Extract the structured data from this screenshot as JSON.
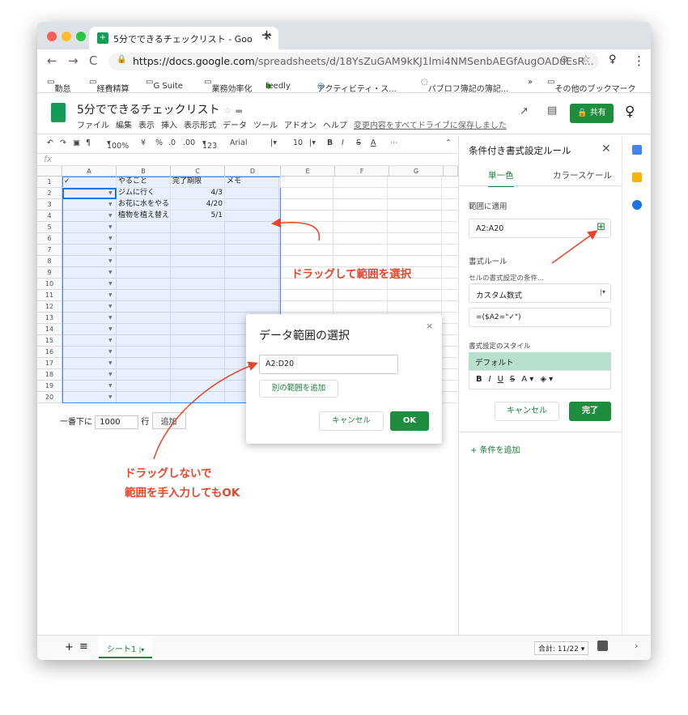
{
  "browser": {
    "tab_title": "5分でできるチェックリスト - Goo",
    "url_host": "https://docs.google.com",
    "url_path": "/spreadsheets/d/18YsZuGAM9kKJ1lmi4NMSenbAEGfAugOADuEsR...",
    "bookmarks": [
      "勤怠",
      "経費精算",
      "G Suite",
      "業務効率化",
      "feedly",
      "アクティビティ・ス...",
      "パブロフ簿記の簿記...",
      "»",
      "その他のブックマーク"
    ]
  },
  "doc": {
    "title": "5分でできるチェックリスト",
    "menus": [
      "ファイル",
      "編集",
      "表示",
      "挿入",
      "表示形式",
      "データ",
      "ツール",
      "アドオン",
      "ヘルプ"
    ],
    "saved_text": "変更内容をすべてドライブに保存しました",
    "share_label": "共有"
  },
  "toolbar": {
    "zoom": "100%",
    "currency": "¥",
    "percent": "%",
    "dec_less": ".0",
    "dec_more": ".00",
    "format": "123",
    "font": "Arial",
    "size": "10",
    "bold": "B",
    "italic": "I",
    "strike": "S",
    "color": "A",
    "more": "⋯"
  },
  "fx": "fx",
  "grid": {
    "columns": [
      "A",
      "B",
      "C",
      "D",
      "E",
      "F",
      "G"
    ],
    "rows": [
      "1",
      "2",
      "3",
      "4",
      "5",
      "6",
      "7",
      "8",
      "9",
      "10",
      "11",
      "12",
      "13",
      "14",
      "15",
      "16",
      "17",
      "18",
      "19",
      "20"
    ],
    "header": [
      "✓",
      "やること",
      "完了期限",
      "メモ"
    ],
    "data": [
      {
        "task": "ジムに行く",
        "due": "4/3"
      },
      {
        "task": "お花に水をやる",
        "due": "4/20"
      },
      {
        "task": "植物を植え替え",
        "due": "5/1"
      }
    ]
  },
  "below_grid": {
    "prefix": "一番下に",
    "count": "1000",
    "suffix": "行",
    "add": "追加"
  },
  "sheet_tab": "シート1",
  "sum_label": "合計: 11/22",
  "panel": {
    "title": "条件付き書式設定ルール",
    "tab_single": "単一色",
    "tab_scale": "カラースケール",
    "range_label": "範囲に適用",
    "range_value": "A2:A20",
    "rules_label": "書式ルール",
    "condition_label": "セルの書式設定の条件...",
    "condition_value": "カスタム数式",
    "formula": "=($A2=\"✓\")",
    "style_label": "書式設定のスタイル",
    "style_value": "デフォルト",
    "cancel": "キャンセル",
    "done": "完了",
    "add_rule": "+ 条件を追加"
  },
  "dialog": {
    "title": "データ範囲の選択",
    "range": "A2:D20",
    "add_range": "別の範囲を追加",
    "cancel": "キャンセル",
    "ok": "OK"
  },
  "annotations": {
    "drag": "ドラッグして範囲を選択",
    "manual_line1": "ドラッグしないで",
    "manual_line2": "範囲を手入力してもOK"
  },
  "colors": {
    "green": "#1e8e3e",
    "annotation": "#e8452c",
    "selection": "#4285f4"
  }
}
